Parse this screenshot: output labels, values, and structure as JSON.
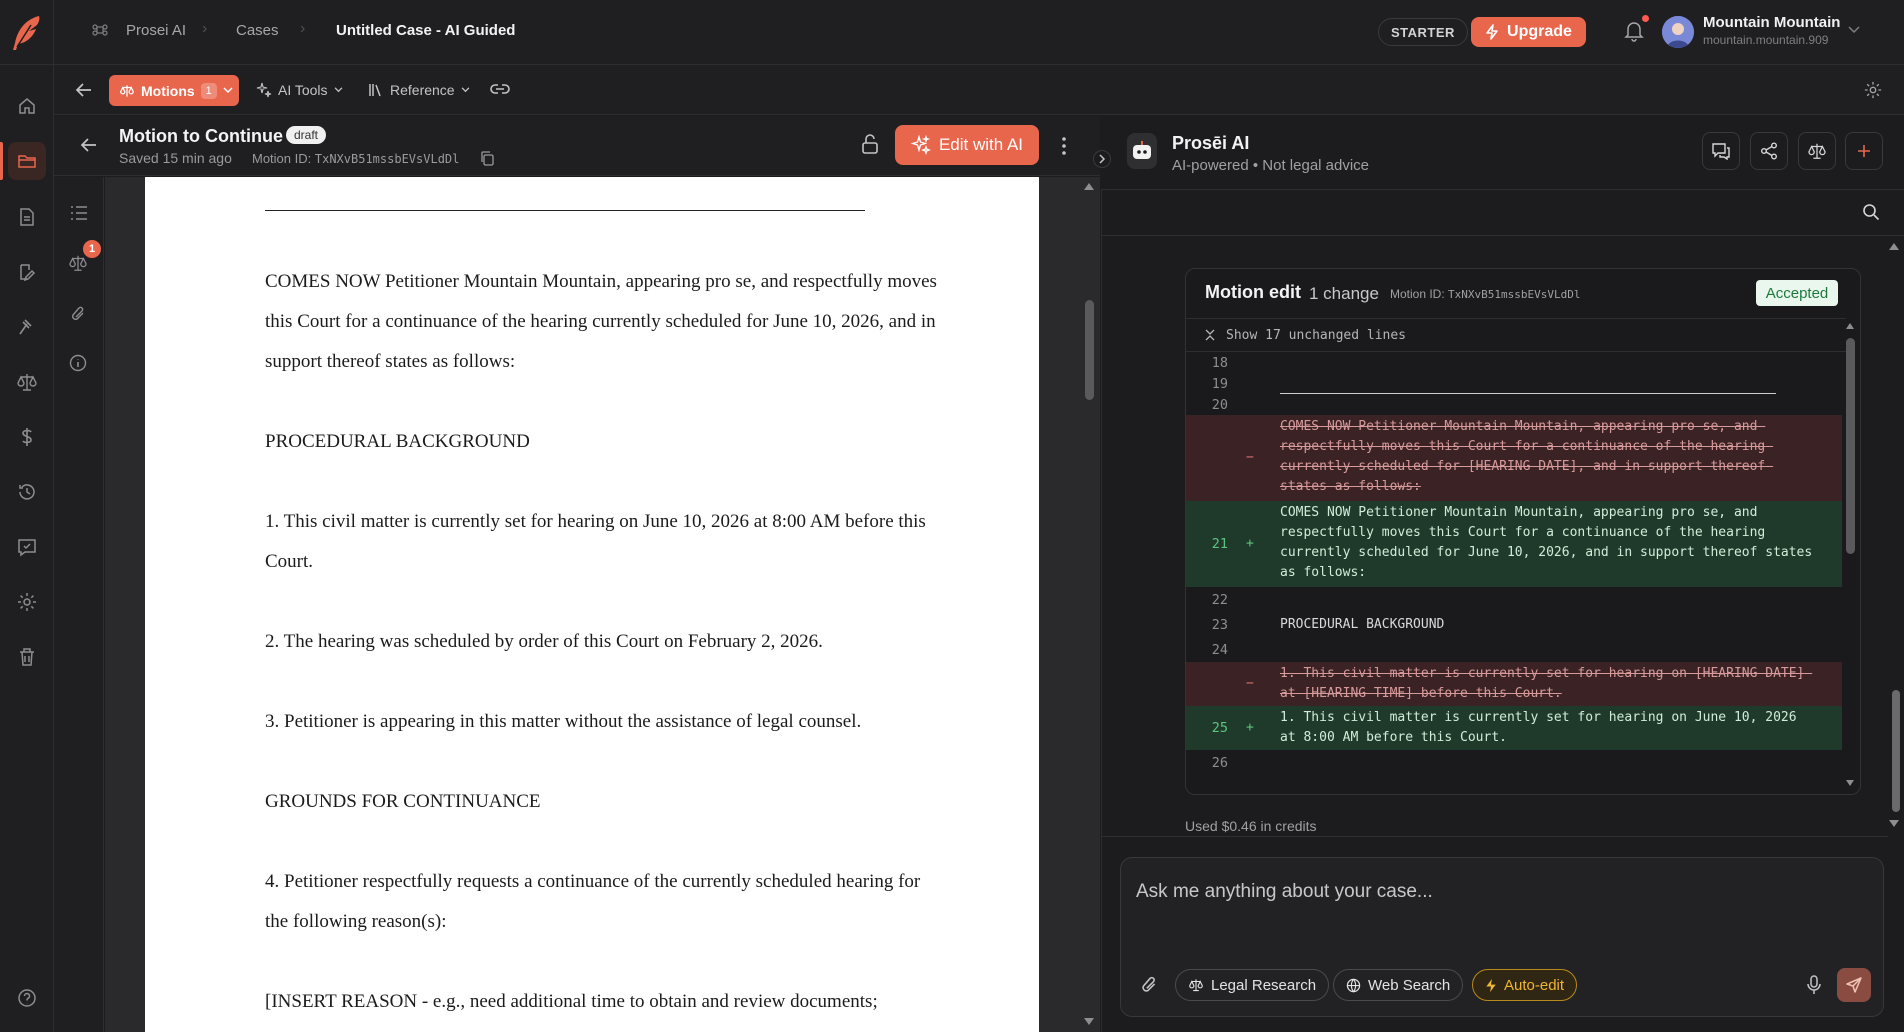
{
  "app": {
    "name": "Prosei AI",
    "breadcrumbs": [
      "Prosei AI",
      "Cases",
      "Untitled Case - AI Guided"
    ],
    "plan_badge": "STARTER",
    "upgrade_label": "Upgrade",
    "user": {
      "name": "Mountain Mountain",
      "handle": "mountain.mountain.909"
    },
    "accent_color": "#e8664c"
  },
  "sidebar": {
    "items": [
      "home-icon",
      "folder-icon",
      "document-icon",
      "edit-document-icon",
      "gavel-icon",
      "scales-icon",
      "dollar-icon",
      "history-icon",
      "chat-icon",
      "settings-icon",
      "trash-icon",
      "help-icon"
    ]
  },
  "toolbar": {
    "motions_label": "Motions",
    "motions_count": "1",
    "ai_tools_label": "AI Tools",
    "reference_label": "Reference"
  },
  "document": {
    "title": "Motion to Continue",
    "status": "draft",
    "saved": "Saved 15 min ago",
    "motion_id_label": "Motion ID:",
    "motion_id": "TxNXvB51mssbEVsVLdDl",
    "edit_label": "Edit with AI",
    "gutter_badge": "1",
    "paragraphs": [
      "COMES NOW Petitioner Mountain Mountain, appearing pro se, and respectfully moves this Court for a continuance of the hearing currently scheduled for June 10, 2026, and in support thereof states as follows:",
      "PROCEDURAL BACKGROUND",
      "1. This civil matter is currently set for hearing on June 10, 2026 at 8:00 AM before this Court.",
      "2. The hearing was scheduled by order of this Court on February 2, 2026.",
      "3. Petitioner is appearing in this matter without the assistance of legal counsel.",
      "GROUNDS FOR CONTINUANCE",
      "4. Petitioner respectfully requests a continuance of the currently scheduled hearing for the following reason(s):",
      "[INSERT REASON - e.g., need additional time to obtain and review documents;"
    ]
  },
  "ai_panel": {
    "name": "Prosēi AI",
    "subtitle": "AI-powered • Not legal advice",
    "diff": {
      "title": "Motion edit",
      "changes": "1 change",
      "motion_id": "Motion ID: TxNXvB51mssbEVsVLdDl",
      "status": "Accepted",
      "unchanged_label": "Show 17 unchanged lines",
      "lines": [
        {
          "num": "18",
          "type": "ctx",
          "text": ""
        },
        {
          "num": "19",
          "type": "ctx",
          "text": ""
        },
        {
          "num": "20",
          "type": "ctx",
          "text": ""
        },
        {
          "num": "",
          "type": "del",
          "text": "COMES NOW Petitioner Mountain Mountain, appearing pro se, and respectfully moves this Court for a continuance of the hearing currently scheduled for [HEARING DATE], and in support thereof states as follows:"
        },
        {
          "num": "21",
          "type": "add",
          "text": "COMES NOW Petitioner Mountain Mountain, appearing pro se, and respectfully moves this Court for a continuance of the hearing currently scheduled for June 10, 2026, and in support thereof states as follows:"
        },
        {
          "num": "22",
          "type": "ctx",
          "text": ""
        },
        {
          "num": "23",
          "type": "ctx",
          "text": "PROCEDURAL BACKGROUND"
        },
        {
          "num": "24",
          "type": "ctx",
          "text": ""
        },
        {
          "num": "",
          "type": "del",
          "text": "1. This civil matter is currently set for hearing on [HEARING DATE] at [HEARING TIME] before this Court."
        },
        {
          "num": "25",
          "type": "add",
          "text": "1. This civil matter is currently set for hearing on June 10, 2026 at 8:00 AM before this Court."
        },
        {
          "num": "26",
          "type": "ctx",
          "text": ""
        }
      ]
    },
    "credits": "Used $0.46 in credits",
    "composer": {
      "placeholder": "Ask me anything about your case...",
      "chips": [
        "Legal Research",
        "Web Search",
        "Auto-edit"
      ]
    }
  }
}
